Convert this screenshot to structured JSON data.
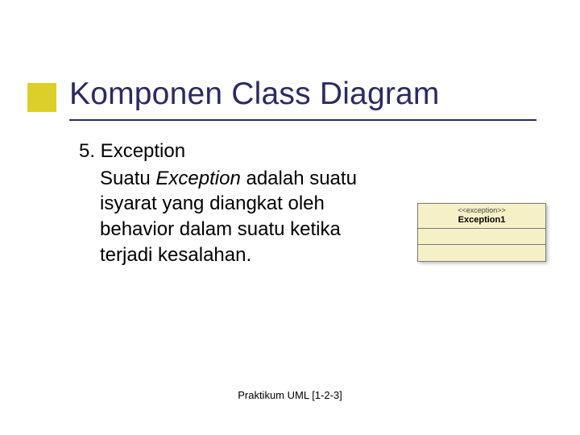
{
  "title": "Komponen Class Diagram",
  "section": {
    "heading": "5. Exception",
    "body_pre": "Suatu ",
    "body_italic": "Exception",
    "body_post": " adalah suatu isyarat yang diangkat oleh behavior dalam suatu ketika terjadi kesalahan."
  },
  "uml": {
    "stereotype": "<<exception>>",
    "name": "Exception1"
  },
  "footer": "Praktikum UML [1-2-3]",
  "accent_color": "#dccf2a"
}
